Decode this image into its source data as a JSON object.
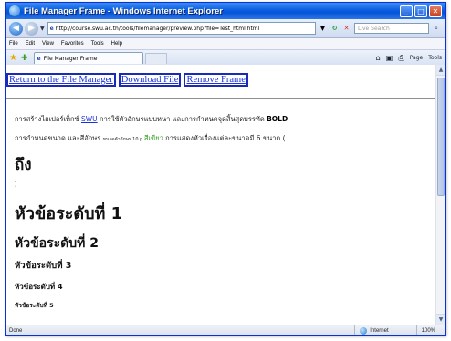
{
  "window": {
    "title": "File Manager Frame - Windows Internet Explorer",
    "minimize": "_",
    "maximize": "□",
    "close": "✕"
  },
  "address_bar": {
    "url": "http://course.swu.ac.th/tools/filemanager/preview.php?file=Test_html.html",
    "search_placeholder": "Live Search"
  },
  "menu": [
    "File",
    "Edit",
    "View",
    "Favorites",
    "Tools",
    "Help"
  ],
  "tab": {
    "title": "File Manager Frame"
  },
  "toolbar": {
    "page": "Page",
    "tools": "Tools"
  },
  "links": {
    "return": "Return to the File Manager",
    "download": "Download File",
    "remove": "Remove Frame"
  },
  "content": {
    "p1_text": "การสร้างไฮเปอร์เท็กซ์ ",
    "p1_link": "SWU",
    "p1_mid": " การใช้ตัวอักษรแบบหนา และการกำหนดจุดสิ้นสุดบรรทัด ",
    "p1_bold": "BOLD",
    "p2_text": "การกำหนดขนาด และสีอักษร ",
    "p2_small": "ขนาดตัวอักษร 10 p ",
    "p2_green": "สีเขียว",
    "p2_end": " การแสดงหัวเรื่องแต่ละขนาดมี 6 ขนาด (",
    "big_text": "ถึง",
    "paren": ")",
    "h1": "หัวข้อระดับที่ 1",
    "h2": "หัวข้อระดับที่ 2",
    "h3": "หัวข้อระดับที่ 3",
    "h4": "หัวข้อระดับที่ 4",
    "h5": "หัวข้อระดับที่ 5"
  },
  "status": {
    "text": "Done",
    "zone": "Internet",
    "zoom": "100%"
  }
}
